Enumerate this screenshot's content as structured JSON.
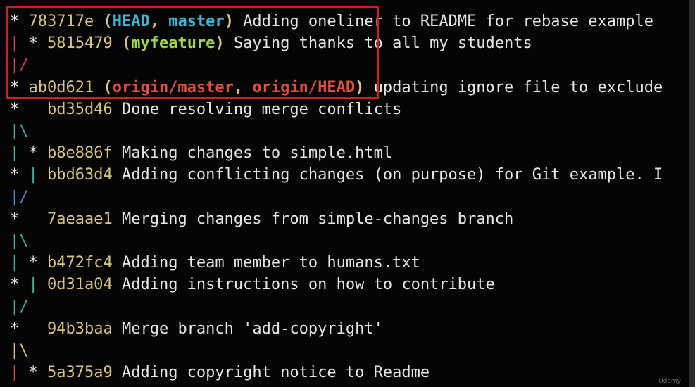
{
  "log": [
    {
      "graph": "* ",
      "hash": "783717e",
      "refs": [
        {
          "text": "HEAD",
          "kind": "head"
        },
        {
          "text": "master",
          "kind": "head"
        }
      ],
      "message": "Adding oneliner to README for rebase example"
    },
    {
      "graph": "| * ",
      "hash": "5815479",
      "refs": [
        {
          "text": "myfeature",
          "kind": "feature"
        }
      ],
      "message": "Saying thanks to all my students"
    },
    {
      "graph": "|/",
      "hash": "",
      "refs": [],
      "message": ""
    },
    {
      "graph": "* ",
      "hash": "ab0d621",
      "refs": [
        {
          "text": "origin/master",
          "kind": "origin"
        },
        {
          "text": "origin/HEAD",
          "kind": "origin"
        }
      ],
      "message": "updating ignore file to exclude"
    },
    {
      "graph": "*   ",
      "hash": "bd35d46",
      "refs": [],
      "message": "Done resolving merge conflicts"
    },
    {
      "graph": "|\\",
      "hash": "",
      "refs": [],
      "message": ""
    },
    {
      "graph": "| * ",
      "hash": "b8e886f",
      "refs": [],
      "message": "Making changes to simple.html"
    },
    {
      "graph": "* | ",
      "hash": "bbd63d4",
      "refs": [],
      "message": "Adding conflicting changes (on purpose) for Git example. I"
    },
    {
      "graph": "|/",
      "hash": "",
      "refs": [],
      "message": ""
    },
    {
      "graph": "*   ",
      "hash": "7aeaae1",
      "refs": [],
      "message": "Merging changes from simple-changes branch"
    },
    {
      "graph": "|\\",
      "hash": "",
      "refs": [],
      "message": ""
    },
    {
      "graph": "| * ",
      "hash": "b472fc4",
      "refs": [],
      "message": "Adding team member to humans.txt"
    },
    {
      "graph": "* | ",
      "hash": "0d31a04",
      "refs": [],
      "message": "Adding instructions on how to contribute"
    },
    {
      "graph": "|/",
      "hash": "",
      "refs": [],
      "message": ""
    },
    {
      "graph": "*   ",
      "hash": "94b3baa",
      "refs": [],
      "message": "Merge branch 'add-copyright'"
    },
    {
      "graph": "|\\",
      "hash": "",
      "refs": [],
      "message": ""
    },
    {
      "graph": "| * ",
      "hash": "5a375a9",
      "refs": [],
      "message": "Adding copyright notice to Readme"
    }
  ],
  "colors": {
    "hash": "#d8c47a",
    "ref_head": "#3fb6d8",
    "ref_feature": "#9ed74a",
    "ref_origin": "#e0503c",
    "highlight_border": "#d21e22"
  },
  "watermark": "Udemy"
}
